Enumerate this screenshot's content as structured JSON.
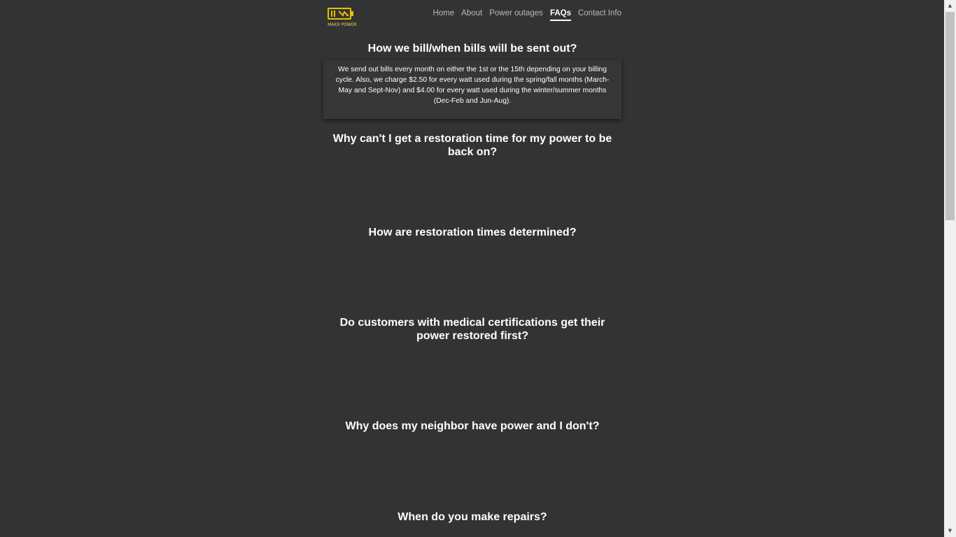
{
  "header": {
    "logo_text": "MAXX POWER",
    "nav": [
      {
        "label": "Home",
        "active": false
      },
      {
        "label": "About",
        "active": false
      },
      {
        "label": "Power outages",
        "active": false
      },
      {
        "label": "FAQs",
        "active": true
      },
      {
        "label": "Contact Info",
        "active": false
      }
    ]
  },
  "faqs": [
    {
      "question": "How we bill/when bills will be sent out?",
      "answer": "We send out bills every month on either the 1st or the 15th depending on your billing cycle. Also, we charge $2.50 for every watt used during the spring/fall months (March-May and Sept-Nov) and $4.00 for every watt used during the winter/summer months (Dec-Feb and Jun-Aug)."
    },
    {
      "question": "Why can't I get a restoration time for my power to be back on?"
    },
    {
      "question": "How are restoration times determined?"
    },
    {
      "question": "Do customers with medical certifications get their power restored first?"
    },
    {
      "question": "Why does my neighbor have power and I don't?"
    },
    {
      "question": "When do you make repairs?"
    }
  ],
  "colors": {
    "background": "#333333",
    "logo_accent": "#e5c100",
    "text": "#ffffff",
    "nav_inactive": "#b9b9b9"
  },
  "icons": {
    "logo": "battery-bolt-icon",
    "scroll_up": "scroll-up-arrow-icon",
    "scroll_down": "scroll-down-arrow-icon"
  }
}
